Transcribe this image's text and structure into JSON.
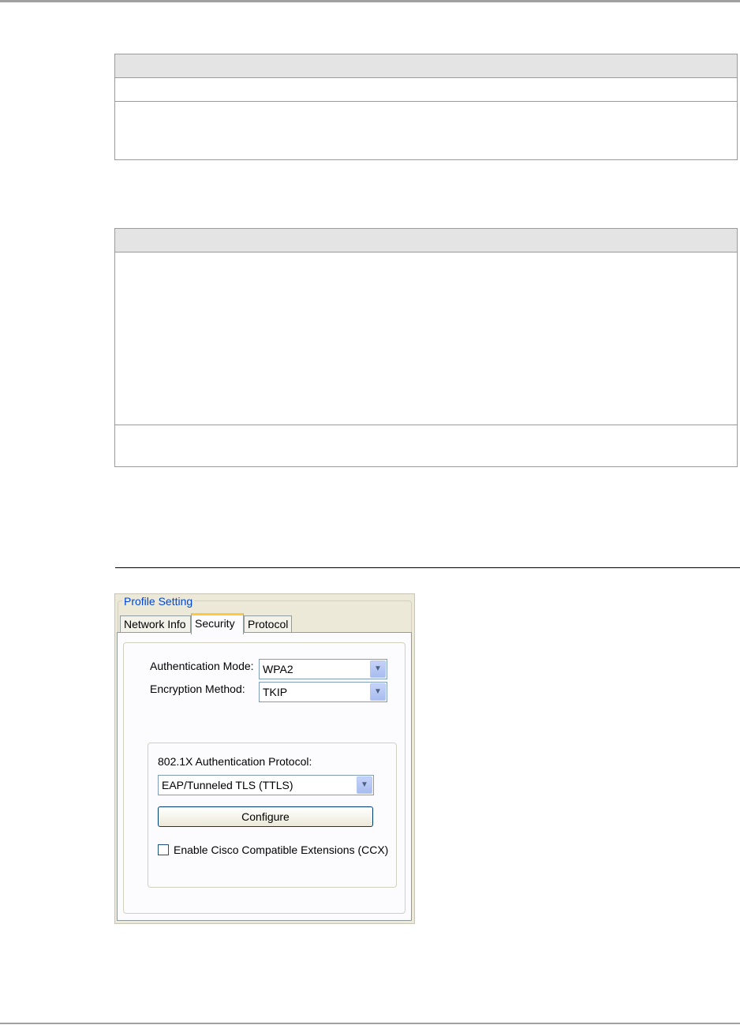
{
  "dialog": {
    "group_title": "Profile Setting",
    "tabs": [
      {
        "label": "Network Info",
        "active": false
      },
      {
        "label": "Security",
        "active": true
      },
      {
        "label": "Protocol",
        "active": false
      }
    ],
    "auth_mode": {
      "label": "Authentication Mode:",
      "value": "WPA2"
    },
    "encryption": {
      "label": "Encryption Method:",
      "value": "TKIP"
    },
    "protocol": {
      "label": "802.1X Authentication Protocol:",
      "value": "EAP/Tunneled TLS (TTLS)"
    },
    "configure_label": "Configure",
    "ccx": {
      "label": "Enable Cisco Compatible Extensions (CCX)",
      "checked": false
    }
  }
}
